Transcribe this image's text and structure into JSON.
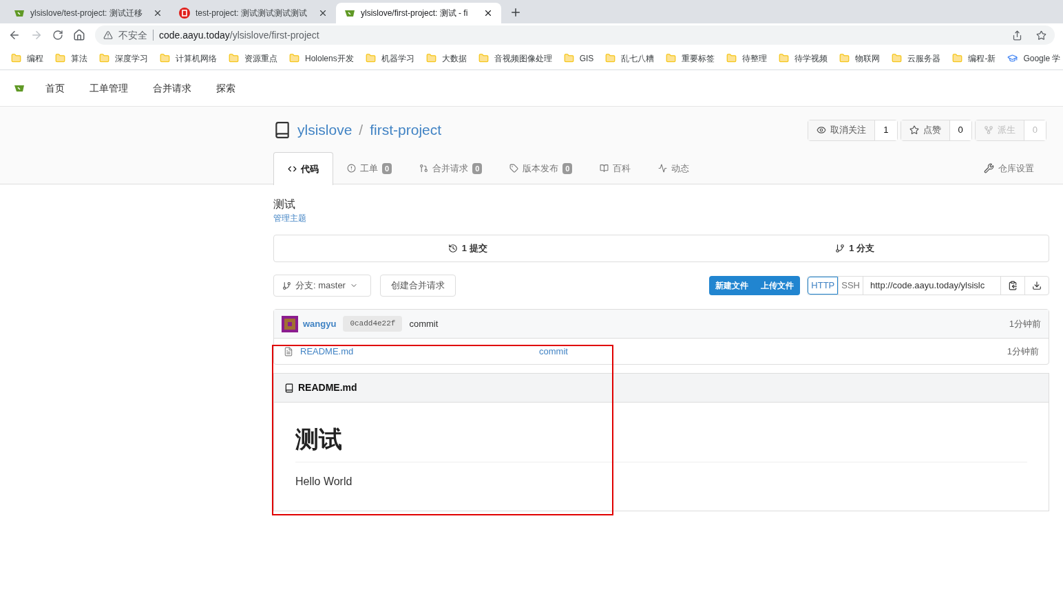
{
  "browser": {
    "tabs": [
      {
        "title": "ylsislove/test-project: 测试迁移",
        "kind": "cup",
        "selected": false
      },
      {
        "title": "test-project: 测试测试测试测试",
        "kind": "badge",
        "selected": false
      },
      {
        "title": "ylsislove/first-project: 测试 - fi",
        "kind": "cup",
        "selected": true
      }
    ],
    "address": {
      "security": "不安全",
      "host": "code.aayu.today",
      "path": "/ylsislove/first-project"
    },
    "bookmarks": [
      {
        "label": "编程",
        "kind": "folder"
      },
      {
        "label": "算法",
        "kind": "folder"
      },
      {
        "label": "深度学习",
        "kind": "folder"
      },
      {
        "label": "计算机网络",
        "kind": "folder"
      },
      {
        "label": "资源重点",
        "kind": "folder"
      },
      {
        "label": "Hololens开发",
        "kind": "folder"
      },
      {
        "label": "机器学习",
        "kind": "folder"
      },
      {
        "label": "大数据",
        "kind": "folder"
      },
      {
        "label": "音视频图像处理",
        "kind": "folder"
      },
      {
        "label": "GIS",
        "kind": "folder"
      },
      {
        "label": "乱七八糟",
        "kind": "folder"
      },
      {
        "label": "重要标签",
        "kind": "folder"
      },
      {
        "label": "待整理",
        "kind": "folder"
      },
      {
        "label": "待学视频",
        "kind": "folder"
      },
      {
        "label": "物联网",
        "kind": "folder"
      },
      {
        "label": "云服务器",
        "kind": "folder"
      },
      {
        "label": "编程-新",
        "kind": "folder"
      },
      {
        "label": "Google 学",
        "kind": "site"
      }
    ]
  },
  "nav": {
    "items": [
      "首页",
      "工单管理",
      "合并请求",
      "探索"
    ]
  },
  "repo": {
    "owner": "ylsislove",
    "separator": "/",
    "name": "first-project",
    "actions": [
      {
        "label": "取消关注",
        "count": "1",
        "kind": "eye",
        "disabled": false
      },
      {
        "label": "点赞",
        "count": "0",
        "kind": "star",
        "disabled": false
      },
      {
        "label": "派生",
        "count": "0",
        "kind": "fork",
        "disabled": true
      }
    ],
    "tabs": [
      {
        "label": "代码",
        "kind": "code",
        "selected": true
      },
      {
        "label": "工单",
        "kind": "issue",
        "count": "0",
        "selected": false
      },
      {
        "label": "合并请求",
        "kind": "pr",
        "count": "0",
        "selected": false
      },
      {
        "label": "版本发布",
        "kind": "tag",
        "count": "0",
        "selected": false
      },
      {
        "label": "百科",
        "kind": "book",
        "selected": false
      },
      {
        "label": "动态",
        "kind": "pulse",
        "selected": false
      }
    ],
    "settings": "仓库设置"
  },
  "description": "测试",
  "topics_link": "管理主题",
  "stats": [
    {
      "label": "1 提交",
      "kind": "history"
    },
    {
      "label": "1 分支",
      "kind": "branch"
    }
  ],
  "toolbar": {
    "branch": "分支: master",
    "create_pr": "创建合并请求",
    "file_buttons": [
      "新建文件",
      "上传文件"
    ],
    "protocols": [
      {
        "label": "HTTP",
        "selected": true
      },
      {
        "label": "SSH",
        "selected": false
      }
    ],
    "clone_url": "http://code.aayu.today/ylsislc"
  },
  "latest_commit": {
    "author": "wangyu",
    "sha": "0cadd4e22f",
    "message": "commit",
    "time": "1分钟前"
  },
  "files": [
    {
      "name": "README.md",
      "message": "commit",
      "time": "1分钟前"
    }
  ],
  "readme": {
    "title": "README.md",
    "heading": "测试",
    "body": "Hello World"
  }
}
